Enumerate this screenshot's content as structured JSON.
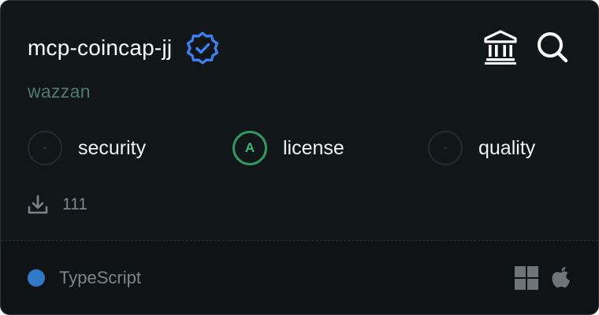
{
  "card": {
    "title": "mcp-coincap-jj",
    "author": "wazzan",
    "icons": {
      "verified": "verified-badge-icon",
      "bank": "bank-icon",
      "search": "search-icon",
      "download": "download-icon",
      "windows": "windows-icon",
      "apple": "apple-icon"
    },
    "scores": [
      {
        "grade": "-",
        "label": "security"
      },
      {
        "grade": "A",
        "label": "license"
      },
      {
        "grade": "-",
        "label": "quality"
      }
    ],
    "downloads": "111",
    "language": {
      "name": "TypeScript",
      "color": "#3178c6"
    },
    "colors": {
      "background": "#111619",
      "author": "#4e7a6f",
      "verified": "#3b82f6",
      "grade_good": "#2f9a63"
    }
  }
}
